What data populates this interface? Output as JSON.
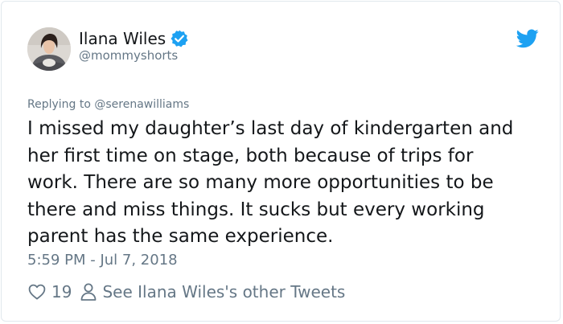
{
  "author": {
    "display_name": "Ilana Wiles",
    "handle": "@mommyshorts",
    "verified": true
  },
  "reply_context": "Replying to @serenawilliams",
  "tweet": {
    "lines": [
      "I missed my daughter’s last day of kindergarten and",
      "her first time on stage, both because of trips for",
      "work. There are so many more opportunities to be",
      "there and miss things. It sucks but every working",
      "parent has the same experience."
    ],
    "timestamp": "5:59 PM - Jul 7, 2018"
  },
  "actions": {
    "like_count": "19",
    "other_tweets_label": "See Ilana Wiles's other Tweets"
  },
  "icons": {
    "brand": "twitter-bird-icon",
    "verified": "verified-badge-icon",
    "like": "heart-icon",
    "profile": "person-icon"
  },
  "colors": {
    "brand_blue": "#1da1f2",
    "text_primary": "#14171a",
    "text_secondary": "#657786",
    "border": "#e1e8ed"
  }
}
